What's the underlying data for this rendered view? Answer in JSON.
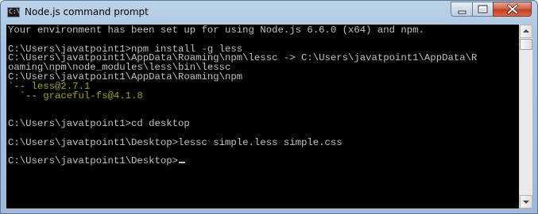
{
  "window": {
    "title": "Node.js command prompt",
    "icon": "cmd-icon",
    "icon_glyph": "C:\\"
  },
  "controls": {
    "minimize": "minimize-icon",
    "maximize": "maximize-icon",
    "close": "close-icon"
  },
  "console": {
    "lines": [
      {
        "text": "Your environment has been set up for using Node.js 6.6.0 (x64) and npm."
      },
      {
        "text": ""
      },
      {
        "text": "C:\\Users\\javatpoint1>npm install -g less"
      },
      {
        "text": "C:\\Users\\javatpoint1\\AppData\\Roaming\\npm\\lessc -> C:\\Users\\javatpoint1\\AppData\\R"
      },
      {
        "text": "oaming\\npm\\node_modules\\less\\bin\\lessc"
      },
      {
        "text": "C:\\Users\\javatpoint1\\AppData\\Roaming\\npm"
      },
      {
        "prefix": "`-- ",
        "text": "less@2.7.1"
      },
      {
        "prefix": "  `-- ",
        "text": "graceful-fs@4.1.8"
      },
      {
        "text": ""
      },
      {
        "text": ""
      },
      {
        "text": "C:\\Users\\javatpoint1>cd desktop"
      },
      {
        "text": ""
      },
      {
        "text": "C:\\Users\\javatpoint1\\Desktop>lessc simple.less simple.css"
      },
      {
        "text": ""
      },
      {
        "text": "C:\\Users\\javatpoint1\\Desktop>"
      }
    ]
  },
  "colors": {
    "background": "#000000",
    "text": "#c0c0c0",
    "package_highlight": "#a3a300"
  }
}
